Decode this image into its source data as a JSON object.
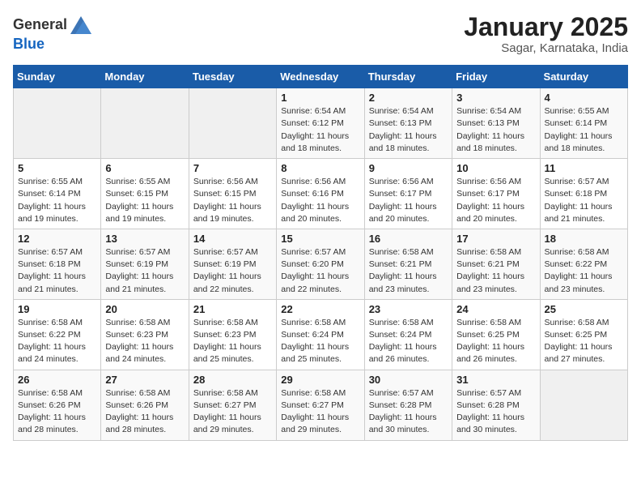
{
  "header": {
    "logo_general": "General",
    "logo_blue": "Blue",
    "title": "January 2025",
    "subtitle": "Sagar, Karnataka, India"
  },
  "days_of_week": [
    "Sunday",
    "Monday",
    "Tuesday",
    "Wednesday",
    "Thursday",
    "Friday",
    "Saturday"
  ],
  "weeks": [
    [
      {
        "day": "",
        "sunrise": "",
        "sunset": "",
        "daylight": "",
        "empty": true
      },
      {
        "day": "",
        "sunrise": "",
        "sunset": "",
        "daylight": "",
        "empty": true
      },
      {
        "day": "",
        "sunrise": "",
        "sunset": "",
        "daylight": "",
        "empty": true
      },
      {
        "day": "1",
        "sunrise": "Sunrise: 6:54 AM",
        "sunset": "Sunset: 6:12 PM",
        "daylight": "Daylight: 11 hours and 18 minutes."
      },
      {
        "day": "2",
        "sunrise": "Sunrise: 6:54 AM",
        "sunset": "Sunset: 6:13 PM",
        "daylight": "Daylight: 11 hours and 18 minutes."
      },
      {
        "day": "3",
        "sunrise": "Sunrise: 6:54 AM",
        "sunset": "Sunset: 6:13 PM",
        "daylight": "Daylight: 11 hours and 18 minutes."
      },
      {
        "day": "4",
        "sunrise": "Sunrise: 6:55 AM",
        "sunset": "Sunset: 6:14 PM",
        "daylight": "Daylight: 11 hours and 18 minutes."
      }
    ],
    [
      {
        "day": "5",
        "sunrise": "Sunrise: 6:55 AM",
        "sunset": "Sunset: 6:14 PM",
        "daylight": "Daylight: 11 hours and 19 minutes."
      },
      {
        "day": "6",
        "sunrise": "Sunrise: 6:55 AM",
        "sunset": "Sunset: 6:15 PM",
        "daylight": "Daylight: 11 hours and 19 minutes."
      },
      {
        "day": "7",
        "sunrise": "Sunrise: 6:56 AM",
        "sunset": "Sunset: 6:15 PM",
        "daylight": "Daylight: 11 hours and 19 minutes."
      },
      {
        "day": "8",
        "sunrise": "Sunrise: 6:56 AM",
        "sunset": "Sunset: 6:16 PM",
        "daylight": "Daylight: 11 hours and 20 minutes."
      },
      {
        "day": "9",
        "sunrise": "Sunrise: 6:56 AM",
        "sunset": "Sunset: 6:17 PM",
        "daylight": "Daylight: 11 hours and 20 minutes."
      },
      {
        "day": "10",
        "sunrise": "Sunrise: 6:56 AM",
        "sunset": "Sunset: 6:17 PM",
        "daylight": "Daylight: 11 hours and 20 minutes."
      },
      {
        "day": "11",
        "sunrise": "Sunrise: 6:57 AM",
        "sunset": "Sunset: 6:18 PM",
        "daylight": "Daylight: 11 hours and 21 minutes."
      }
    ],
    [
      {
        "day": "12",
        "sunrise": "Sunrise: 6:57 AM",
        "sunset": "Sunset: 6:18 PM",
        "daylight": "Daylight: 11 hours and 21 minutes."
      },
      {
        "day": "13",
        "sunrise": "Sunrise: 6:57 AM",
        "sunset": "Sunset: 6:19 PM",
        "daylight": "Daylight: 11 hours and 21 minutes."
      },
      {
        "day": "14",
        "sunrise": "Sunrise: 6:57 AM",
        "sunset": "Sunset: 6:19 PM",
        "daylight": "Daylight: 11 hours and 22 minutes."
      },
      {
        "day": "15",
        "sunrise": "Sunrise: 6:57 AM",
        "sunset": "Sunset: 6:20 PM",
        "daylight": "Daylight: 11 hours and 22 minutes."
      },
      {
        "day": "16",
        "sunrise": "Sunrise: 6:58 AM",
        "sunset": "Sunset: 6:21 PM",
        "daylight": "Daylight: 11 hours and 23 minutes."
      },
      {
        "day": "17",
        "sunrise": "Sunrise: 6:58 AM",
        "sunset": "Sunset: 6:21 PM",
        "daylight": "Daylight: 11 hours and 23 minutes."
      },
      {
        "day": "18",
        "sunrise": "Sunrise: 6:58 AM",
        "sunset": "Sunset: 6:22 PM",
        "daylight": "Daylight: 11 hours and 23 minutes."
      }
    ],
    [
      {
        "day": "19",
        "sunrise": "Sunrise: 6:58 AM",
        "sunset": "Sunset: 6:22 PM",
        "daylight": "Daylight: 11 hours and 24 minutes."
      },
      {
        "day": "20",
        "sunrise": "Sunrise: 6:58 AM",
        "sunset": "Sunset: 6:23 PM",
        "daylight": "Daylight: 11 hours and 24 minutes."
      },
      {
        "day": "21",
        "sunrise": "Sunrise: 6:58 AM",
        "sunset": "Sunset: 6:23 PM",
        "daylight": "Daylight: 11 hours and 25 minutes."
      },
      {
        "day": "22",
        "sunrise": "Sunrise: 6:58 AM",
        "sunset": "Sunset: 6:24 PM",
        "daylight": "Daylight: 11 hours and 25 minutes."
      },
      {
        "day": "23",
        "sunrise": "Sunrise: 6:58 AM",
        "sunset": "Sunset: 6:24 PM",
        "daylight": "Daylight: 11 hours and 26 minutes."
      },
      {
        "day": "24",
        "sunrise": "Sunrise: 6:58 AM",
        "sunset": "Sunset: 6:25 PM",
        "daylight": "Daylight: 11 hours and 26 minutes."
      },
      {
        "day": "25",
        "sunrise": "Sunrise: 6:58 AM",
        "sunset": "Sunset: 6:25 PM",
        "daylight": "Daylight: 11 hours and 27 minutes."
      }
    ],
    [
      {
        "day": "26",
        "sunrise": "Sunrise: 6:58 AM",
        "sunset": "Sunset: 6:26 PM",
        "daylight": "Daylight: 11 hours and 28 minutes."
      },
      {
        "day": "27",
        "sunrise": "Sunrise: 6:58 AM",
        "sunset": "Sunset: 6:26 PM",
        "daylight": "Daylight: 11 hours and 28 minutes."
      },
      {
        "day": "28",
        "sunrise": "Sunrise: 6:58 AM",
        "sunset": "Sunset: 6:27 PM",
        "daylight": "Daylight: 11 hours and 29 minutes."
      },
      {
        "day": "29",
        "sunrise": "Sunrise: 6:58 AM",
        "sunset": "Sunset: 6:27 PM",
        "daylight": "Daylight: 11 hours and 29 minutes."
      },
      {
        "day": "30",
        "sunrise": "Sunrise: 6:57 AM",
        "sunset": "Sunset: 6:28 PM",
        "daylight": "Daylight: 11 hours and 30 minutes."
      },
      {
        "day": "31",
        "sunrise": "Sunrise: 6:57 AM",
        "sunset": "Sunset: 6:28 PM",
        "daylight": "Daylight: 11 hours and 30 minutes."
      },
      {
        "day": "",
        "sunrise": "",
        "sunset": "",
        "daylight": "",
        "empty": true
      }
    ]
  ]
}
